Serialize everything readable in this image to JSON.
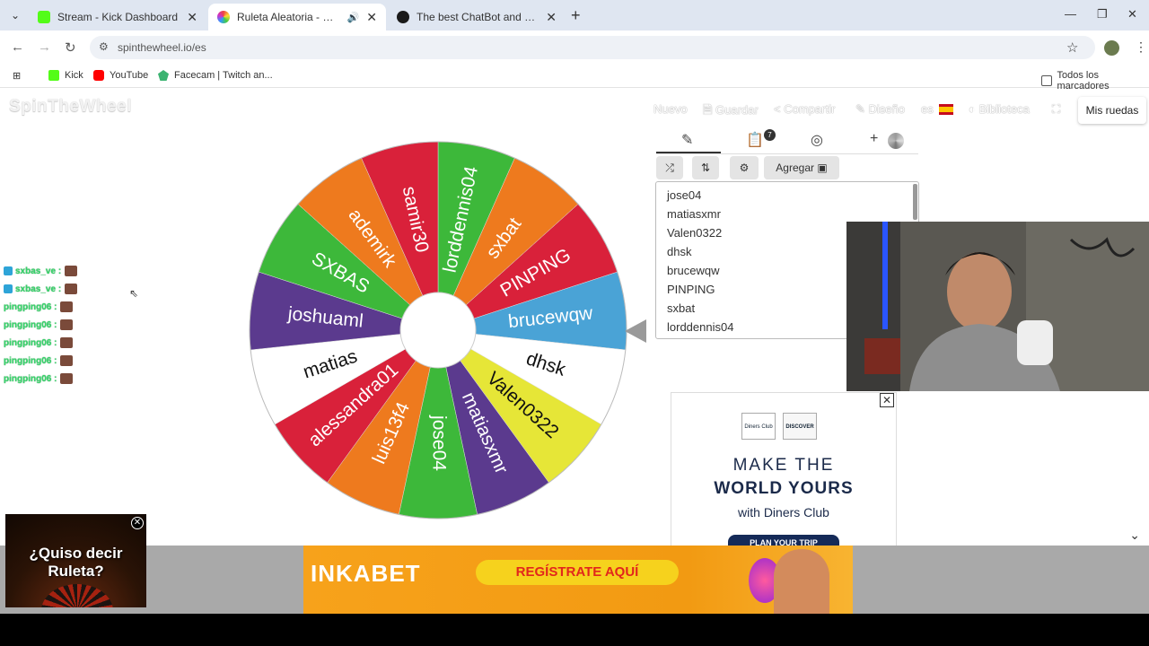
{
  "browser": {
    "tabs": [
      {
        "title": "Stream - Kick Dashboard",
        "active": false,
        "favicon_color": "#53fc18"
      },
      {
        "title": "Ruleta Aleatoria - Selector P",
        "active": true,
        "favicon_color": "#e44"
      },
      {
        "title": "The best ChatBot and Widgets f",
        "active": false,
        "favicon_color": "#1a1a1a"
      }
    ],
    "url": "spinthewheel.io/es",
    "bookmarks": [
      "Kick",
      "YouTube",
      "Facecam | Twitch an...",
      "Todos los marcadores"
    ]
  },
  "site": {
    "logo": "SpinTheWheel",
    "nav": {
      "nuevo": "Nuevo",
      "guardar": "Guardar",
      "compartir": "Compartir",
      "diseno": "Diseño",
      "lang": "es",
      "biblioteca": "Biblioteca",
      "mis_ruedas": "Mis ruedas"
    }
  },
  "chat": [
    {
      "user": "sxbas_ve",
      "sep": ":",
      "badge": true
    },
    {
      "user": "sxbas_ve",
      "sep": ":",
      "badge": true
    },
    {
      "user": "pingping06",
      "sep": ":",
      "badge": false
    },
    {
      "user": "pingping06",
      "sep": ":",
      "badge": false
    },
    {
      "user": "pingping06",
      "sep": ":",
      "badge": false
    },
    {
      "user": "pingping06",
      "sep": ":",
      "badge": false
    },
    {
      "user": "pingping06",
      "sep": ":",
      "badge": false
    }
  ],
  "wheel": {
    "segments": [
      {
        "label": "lorddennis04",
        "color": "#3db83a"
      },
      {
        "label": "sxbat",
        "color": "#ee7a1e"
      },
      {
        "label": "PINPING",
        "color": "#d9213a"
      },
      {
        "label": "brucewqw",
        "color": "#4aa3d6"
      },
      {
        "label": "dhsk",
        "color": "#ffffff"
      },
      {
        "label": "Valen0322",
        "color": "#e6e637"
      },
      {
        "label": "matiasxmr",
        "color": "#5b3a8e"
      },
      {
        "label": "jose04",
        "color": "#3db83a"
      },
      {
        "label": "luis13f4",
        "color": "#ee7a1e"
      },
      {
        "label": "alessandra01",
        "color": "#d9213a"
      },
      {
        "label": "matias",
        "color": "#ffffff"
      },
      {
        "label": "joshuaml",
        "color": "#5b3a8e"
      },
      {
        "label": "SXBAS",
        "color": "#3db83a"
      },
      {
        "label": "ademirk",
        "color": "#ee7a1e"
      },
      {
        "label": "samir30",
        "color": "#d9213a"
      }
    ]
  },
  "editor": {
    "notification_count": "7",
    "agregar": "Agregar",
    "entries": [
      "jose04",
      "matiasxmr",
      "Valen0322",
      "dhsk",
      "brucewqw",
      "PINPING",
      "sxbat",
      "lorddennis04"
    ]
  },
  "ad_diners": {
    "card1": "Diners Club",
    "card2": "DISCOVER",
    "line1": "MAKE THE",
    "line2": "WORLD YOURS",
    "line3": "with Diners Club",
    "cta": "PLAN YOUR TRIP"
  },
  "ad_inkabet": {
    "brand": "INKABET",
    "button": "REGÍSTRATE AQUÍ"
  },
  "overlay": {
    "text": "¿Quiso decir Ruleta?"
  }
}
